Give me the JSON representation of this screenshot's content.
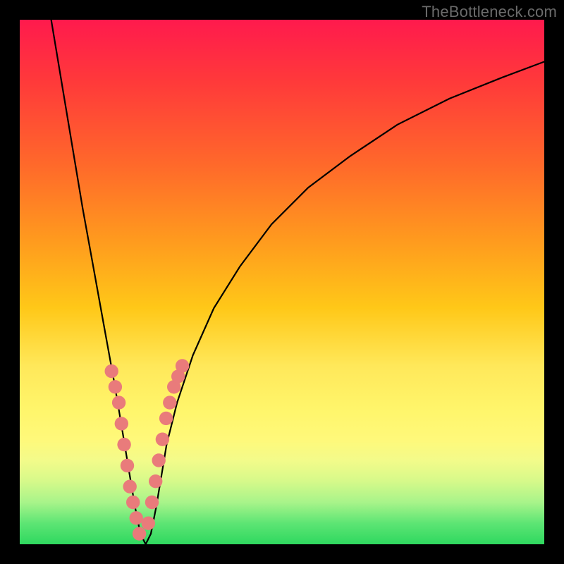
{
  "watermark": "TheBottleneck.com",
  "colors": {
    "frame_bg": "#000000",
    "curve": "#000000",
    "marker": "#e97b7b",
    "gradient_top": "#ff1a4d",
    "gradient_bottom": "#2fd85f"
  },
  "chart_data": {
    "type": "line",
    "title": "",
    "xlabel": "",
    "ylabel": "",
    "xlim": [
      0,
      100
    ],
    "ylim": [
      0,
      100
    ],
    "grid": false,
    "legend": false,
    "note": "V-shaped bottleneck curve; y≈0 at valley near x≈23, rising steeply toward both edges. Values read off pixel grid and normalized 0–100.",
    "series": [
      {
        "name": "bottleneck-curve",
        "x": [
          6,
          8,
          10,
          12,
          14,
          16,
          18,
          19,
          20,
          21,
          22,
          23,
          24,
          25,
          26,
          27,
          28,
          30,
          33,
          37,
          42,
          48,
          55,
          63,
          72,
          82,
          92,
          100
        ],
        "y": [
          100,
          88,
          76,
          64,
          53,
          42,
          31,
          25,
          19,
          13,
          7,
          2,
          0,
          2,
          7,
          13,
          19,
          27,
          36,
          45,
          53,
          61,
          68,
          74,
          80,
          85,
          89,
          92
        ]
      }
    ],
    "markers": [
      {
        "name": "left-cluster",
        "x": [
          17.5,
          18.2,
          18.9,
          19.4,
          19.9,
          20.5,
          21.0,
          21.6,
          22.2,
          22.8
        ],
        "y": [
          33,
          30,
          27,
          23,
          19,
          15,
          11,
          8,
          5,
          2
        ],
        "r": 1.3
      },
      {
        "name": "right-cluster",
        "x": [
          24.5,
          25.2,
          25.9,
          26.5,
          27.2,
          27.9,
          28.6,
          29.4,
          30.2,
          31.0
        ],
        "y": [
          4,
          8,
          12,
          16,
          20,
          24,
          27,
          30,
          32,
          34
        ],
        "r": 1.3
      }
    ]
  }
}
